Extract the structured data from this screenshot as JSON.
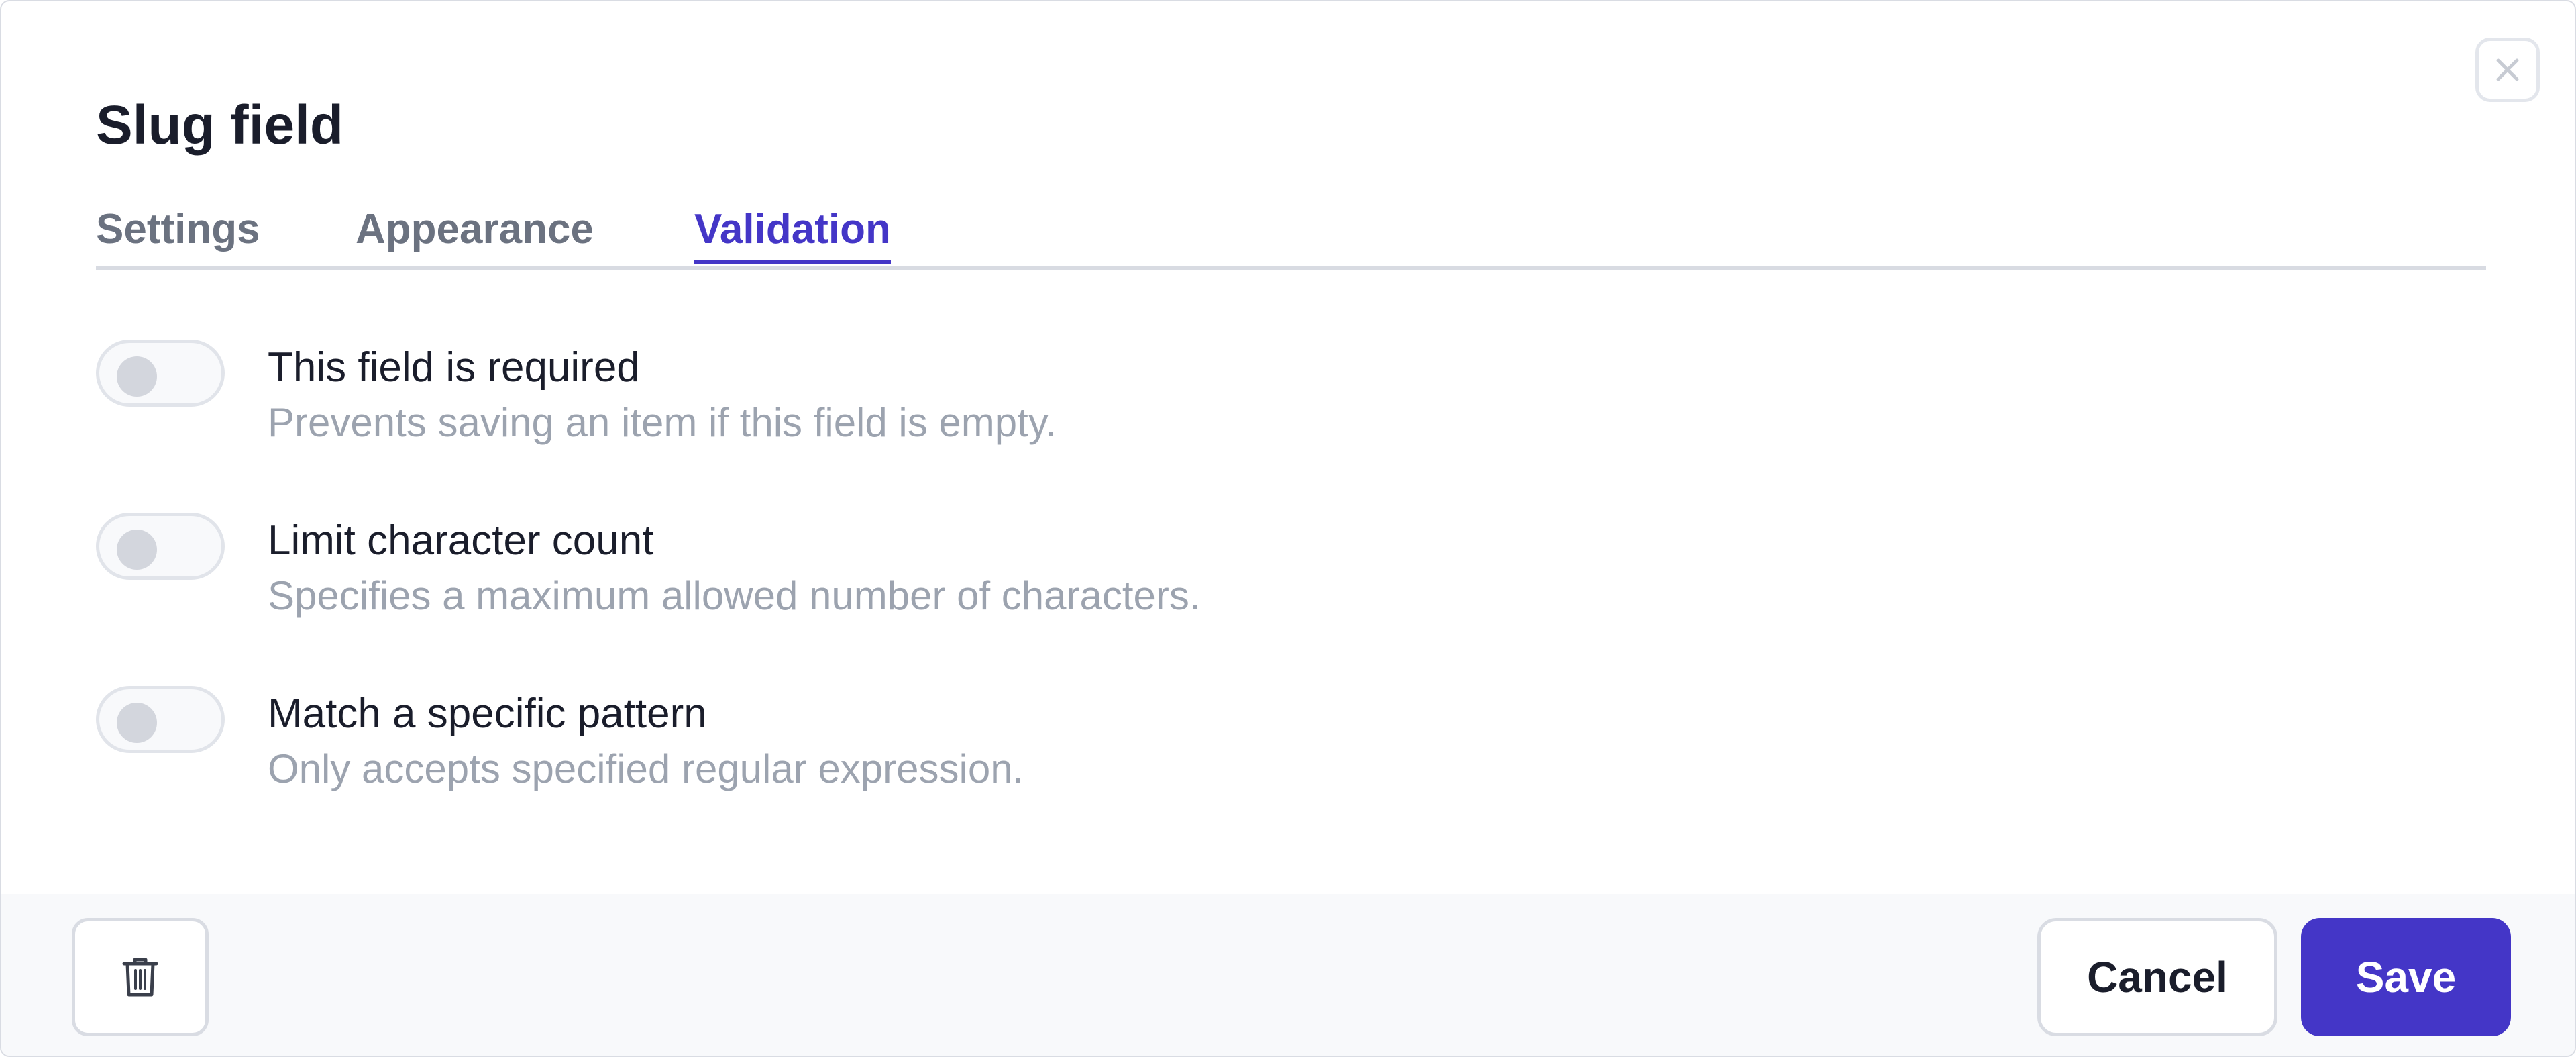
{
  "dialog": {
    "title": "Slug field",
    "close_icon": "close-icon"
  },
  "tabs": [
    {
      "label": "Settings",
      "active": false
    },
    {
      "label": "Appearance",
      "active": false
    },
    {
      "label": "Validation",
      "active": true
    }
  ],
  "validation": {
    "rules": [
      {
        "label": "This field is required",
        "description": "Prevents saving an item if this field is empty.",
        "enabled": false
      },
      {
        "label": "Limit character count",
        "description": "Specifies a maximum allowed number of characters.",
        "enabled": false
      },
      {
        "label": "Match a specific pattern",
        "description": "Only accepts specified regular expression.",
        "enabled": false
      }
    ]
  },
  "footer": {
    "delete_icon": "trash-icon",
    "cancel_label": "Cancel",
    "save_label": "Save"
  },
  "colors": {
    "accent": "#4436c7",
    "title": "#1a1d2b",
    "tab_inactive": "#6b7280",
    "description": "#9ca3af",
    "footer_bg": "#f8f9fb"
  }
}
